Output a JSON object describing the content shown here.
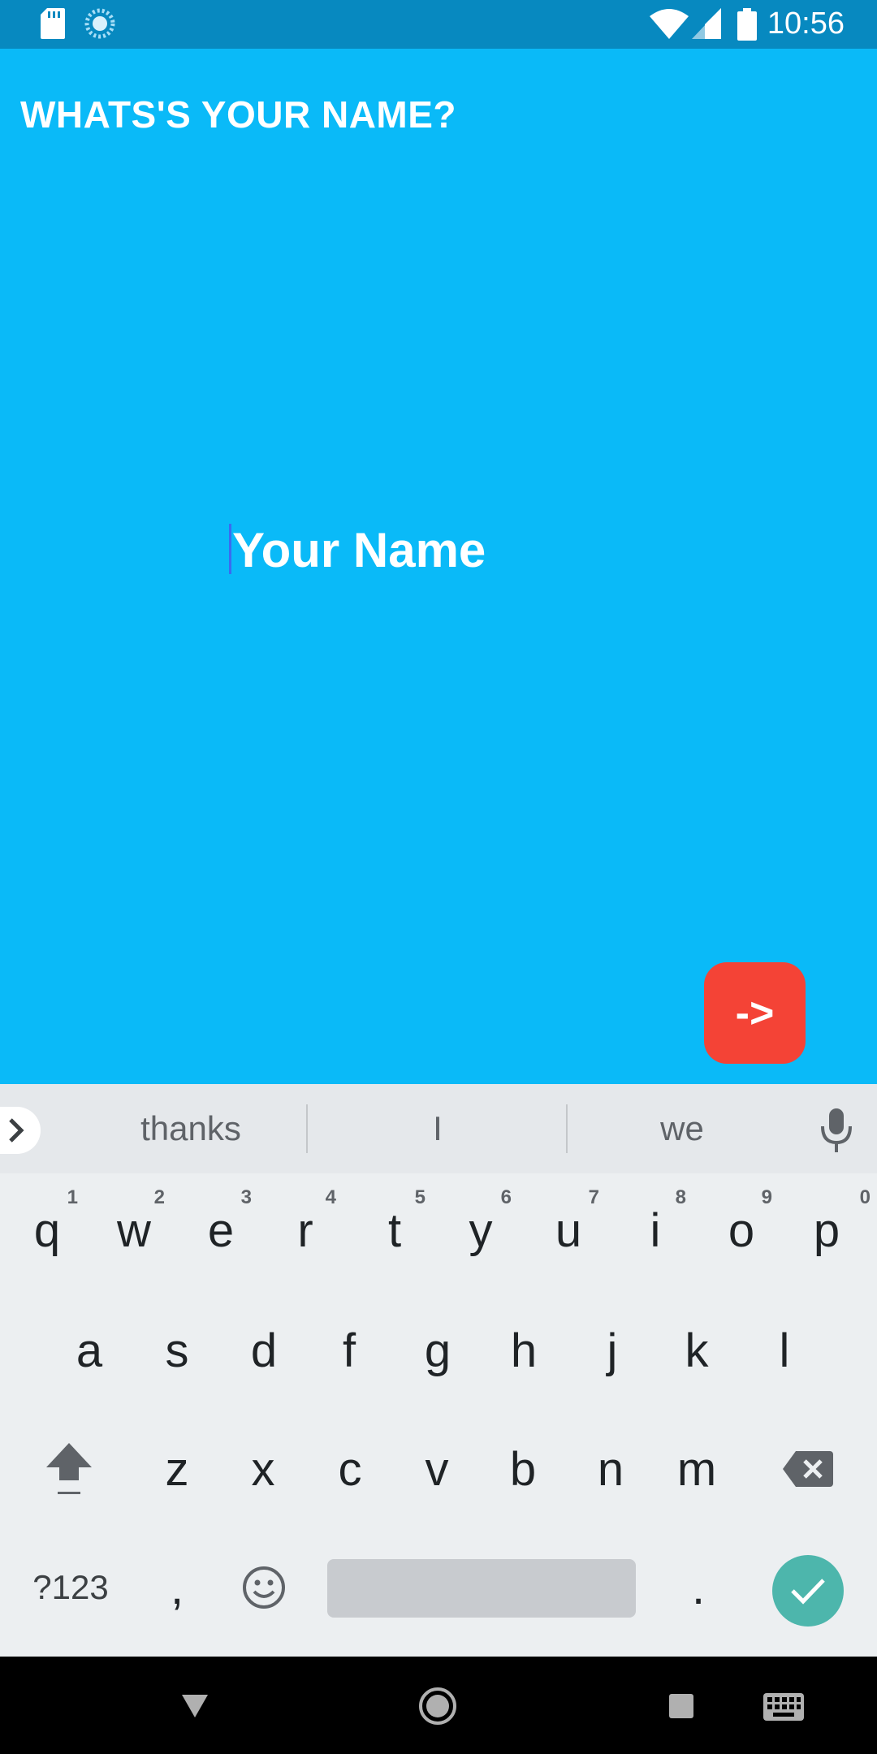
{
  "status_bar": {
    "time": "10:56",
    "icons": [
      "sd-card-icon",
      "sync-icon",
      "wifi-icon",
      "signal-icon",
      "battery-icon"
    ]
  },
  "screen": {
    "question": "WHATS'S YOUR NAME?",
    "name_placeholder": "Your Name",
    "name_value": "",
    "next_label": "->"
  },
  "colors": {
    "background": "#0abaf8",
    "status_bar": "#0789c0",
    "next_button": "#f44336",
    "enter_key": "#4db6ac"
  },
  "keyboard": {
    "suggestions": [
      "thanks",
      "I",
      "we"
    ],
    "row1": [
      {
        "key": "q",
        "hint": "1"
      },
      {
        "key": "w",
        "hint": "2"
      },
      {
        "key": "e",
        "hint": "3"
      },
      {
        "key": "r",
        "hint": "4"
      },
      {
        "key": "t",
        "hint": "5"
      },
      {
        "key": "y",
        "hint": "6"
      },
      {
        "key": "u",
        "hint": "7"
      },
      {
        "key": "i",
        "hint": "8"
      },
      {
        "key": "o",
        "hint": "9"
      },
      {
        "key": "p",
        "hint": "0"
      }
    ],
    "row2": [
      "a",
      "s",
      "d",
      "f",
      "g",
      "h",
      "j",
      "k",
      "l"
    ],
    "row3": [
      "z",
      "x",
      "c",
      "v",
      "b",
      "n",
      "m"
    ],
    "row4": {
      "symbols": "?123",
      "comma": ",",
      "period": "."
    }
  },
  "nav_bar": {
    "icons": [
      "back-icon",
      "home-icon",
      "recents-icon",
      "keyboard-switch-icon"
    ]
  }
}
